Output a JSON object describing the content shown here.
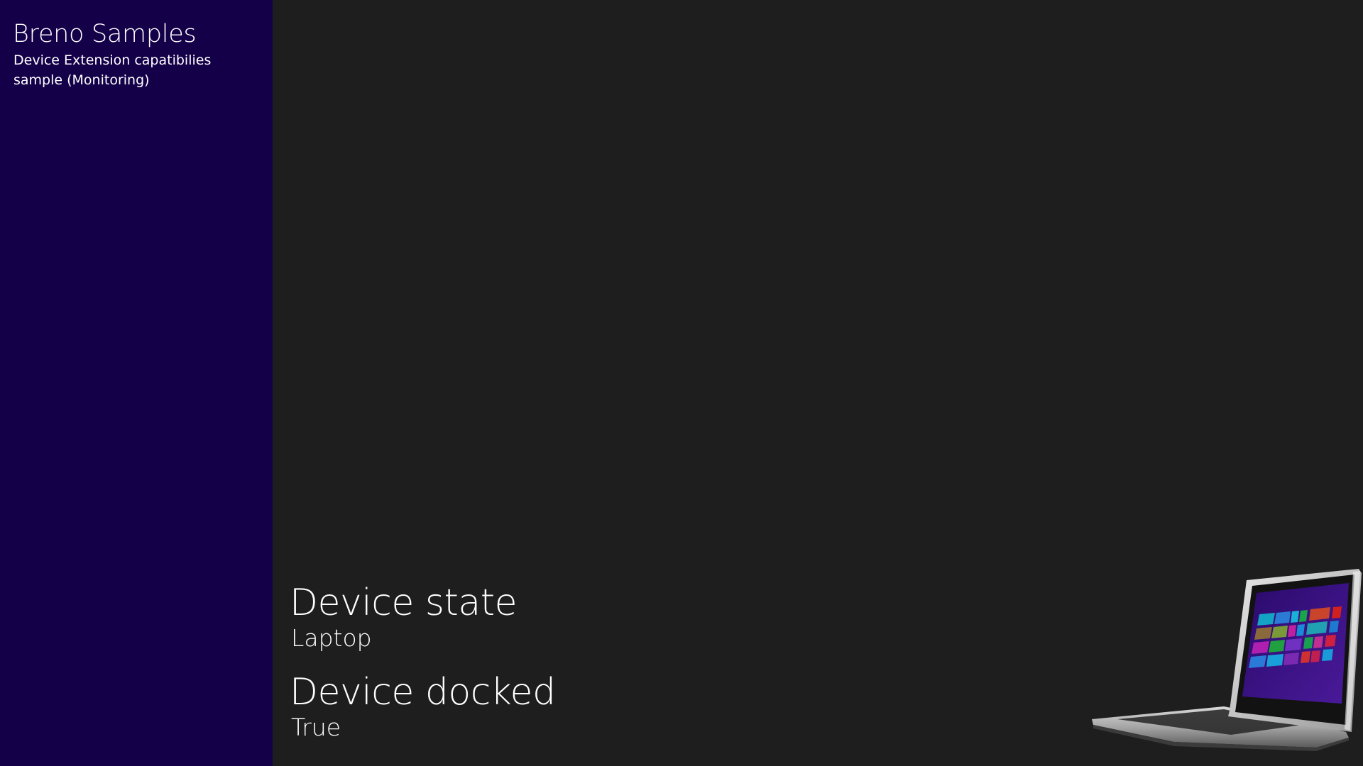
{
  "sidebar": {
    "title": "Breno Samples",
    "subtitle": "Device Extension capatibilies sample (Monitoring)"
  },
  "main": {
    "device_state": {
      "label": "Device state",
      "value": "Laptop"
    },
    "device_docked": {
      "label": "Device docked",
      "value": "True"
    },
    "device_image": {
      "icon": "laptop-icon"
    }
  },
  "colors": {
    "sidebar_background": "#140048",
    "main_background": "#1e1e1e",
    "text": "#ffffff"
  }
}
